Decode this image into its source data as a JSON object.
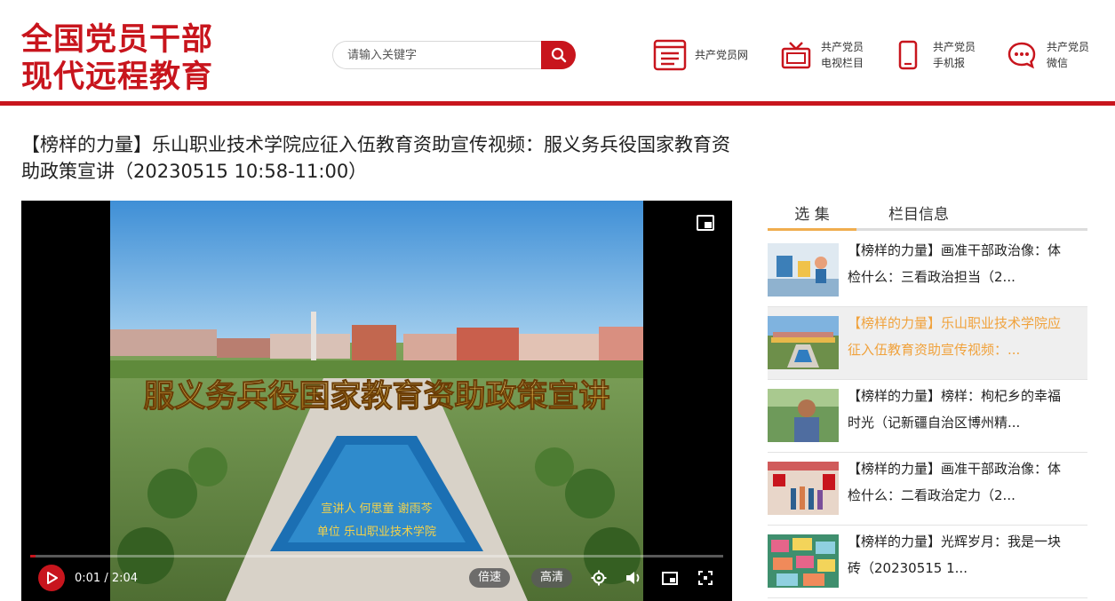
{
  "logo": {
    "line1": "全国党员干部",
    "line2": "现代远程教育"
  },
  "search": {
    "placeholder": "请输入关键字"
  },
  "nav": [
    {
      "icon": "document-list-icon",
      "line1": "共产党员网",
      "line2": ""
    },
    {
      "icon": "tv-icon",
      "line1": "共产党员",
      "line2": "电视栏目"
    },
    {
      "icon": "mobile-phone-icon",
      "line1": "共产党员",
      "line2": "手机报"
    },
    {
      "icon": "wechat-icon",
      "line1": "共产党员",
      "line2": "微信"
    }
  ],
  "page_title": "【榜样的力量】乐山职业技术学院应征入伍教育资助宣传视频：服义务兵役国家教育资助政策宣讲（20230515 10:58-11:00）",
  "player": {
    "overlay_title": "服义务兵役国家教育资助政策宣讲",
    "caption_line1": "宣讲人 何思童  谢雨芩",
    "caption_line2": "单位 乐山职业技术学院",
    "time": "0:01 / 2:04",
    "progress": 0.008,
    "speed_label": "倍速",
    "quality_label": "高清"
  },
  "tabs": {
    "episodes": "选 集",
    "column_info": "栏目信息"
  },
  "episodes": [
    {
      "text": "【榜样的力量】画准干部政治像：体检什么：三看政治担当（2..."
    },
    {
      "text": "【榜样的力量】乐山职业技术学院应征入伍教育资助宣传视频：..."
    },
    {
      "text": "【榜样的力量】榜样：枸杞乡的幸福时光（记新疆自治区博州精..."
    },
    {
      "text": "【榜样的力量】画准干部政治像：体检什么：二看政治定力（2..."
    },
    {
      "text": "【榜样的力量】光辉岁月：我是一块砖（20230515 1..."
    }
  ],
  "colors": {
    "brand_red": "#c8151d",
    "active_orange": "#f0a23c"
  }
}
